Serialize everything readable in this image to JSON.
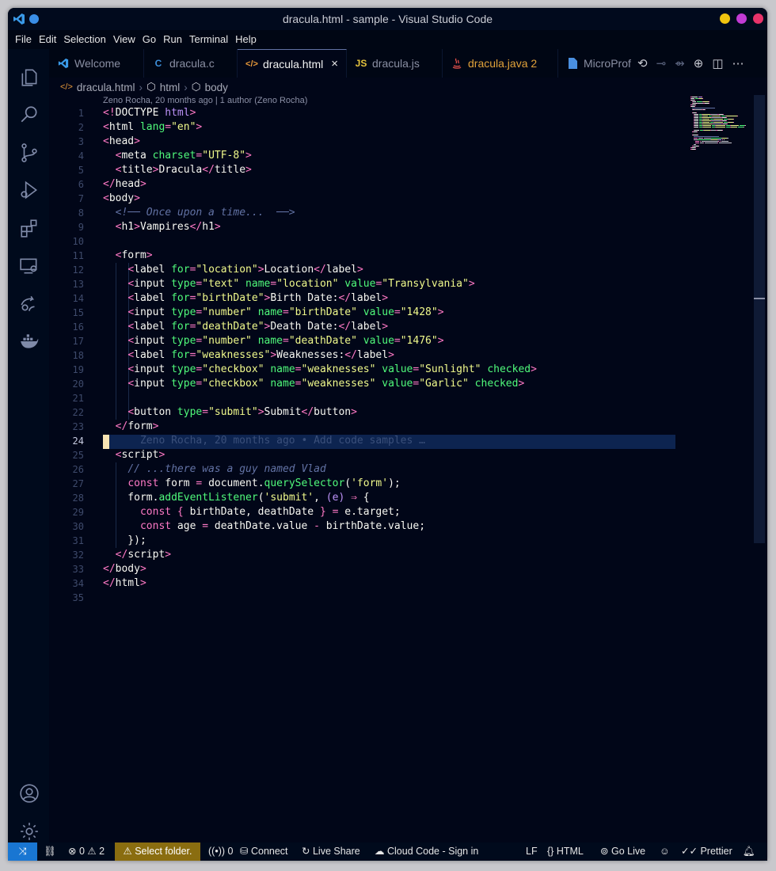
{
  "window": {
    "title": "dracula.html - sample - Visual Studio Code"
  },
  "menu": [
    "File",
    "Edit",
    "Selection",
    "View",
    "Go",
    "Run",
    "Terminal",
    "Help"
  ],
  "tabs": [
    {
      "label": "Welcome",
      "icon": "vscode-logo-icon"
    },
    {
      "label": "dracula.c",
      "icon": "c-file-icon",
      "icon_text": "C"
    },
    {
      "label": "dracula.html",
      "icon": "html-file-icon",
      "icon_text": "</>",
      "active": true
    },
    {
      "label": "dracula.js",
      "icon": "js-file-icon",
      "icon_text": "JS"
    },
    {
      "label": "dracula.java 2",
      "icon": "java-file-icon"
    },
    {
      "label": "MicroProf",
      "icon": "file-icon"
    }
  ],
  "breadcrumb": {
    "file": "dracula.html",
    "item1": "html",
    "item2": "body"
  },
  "blame_header": "Zeno Rocha, 20 months ago | 1 author (Zeno Rocha)",
  "current_line": 24,
  "line_count": 35,
  "code_lines": [
    [
      [
        "t",
        "<!"
      ],
      [
        "tn",
        "DOCTYPE"
      ],
      [
        "p",
        " html"
      ],
      [
        "t",
        ">"
      ]
    ],
    [
      [
        "t",
        "<"
      ],
      [
        "tn",
        "html"
      ],
      [
        "a",
        " lang"
      ],
      [
        "t",
        "="
      ],
      [
        "s",
        "\"en\""
      ],
      [
        "t",
        ">"
      ]
    ],
    [
      [
        "t",
        "<"
      ],
      [
        "tn",
        "head"
      ],
      [
        "t",
        ">"
      ]
    ],
    [
      [
        "v",
        "  "
      ],
      [
        "t",
        "<"
      ],
      [
        "tn",
        "meta"
      ],
      [
        "a",
        " charset"
      ],
      [
        "t",
        "="
      ],
      [
        "s",
        "\"UTF-8\""
      ],
      [
        "t",
        ">"
      ]
    ],
    [
      [
        "v",
        "  "
      ],
      [
        "t",
        "<"
      ],
      [
        "tn",
        "title"
      ],
      [
        "t",
        ">"
      ],
      [
        "v",
        "Dracula"
      ],
      [
        "t",
        "</"
      ],
      [
        "tn",
        "title"
      ],
      [
        "t",
        ">"
      ]
    ],
    [
      [
        "t",
        "</"
      ],
      [
        "tn",
        "head"
      ],
      [
        "t",
        ">"
      ]
    ],
    [
      [
        "t",
        "<"
      ],
      [
        "tn",
        "body"
      ],
      [
        "t",
        ">"
      ]
    ],
    [
      [
        "v",
        "  "
      ],
      [
        "c",
        "<!── Once upon a time...  ──>"
      ]
    ],
    [
      [
        "v",
        "  "
      ],
      [
        "t",
        "<"
      ],
      [
        "tn",
        "h1"
      ],
      [
        "t",
        ">"
      ],
      [
        "v",
        "Vampires"
      ],
      [
        "t",
        "</"
      ],
      [
        "tn",
        "h1"
      ],
      [
        "t",
        ">"
      ]
    ],
    [],
    [
      [
        "v",
        "  "
      ],
      [
        "t",
        "<"
      ],
      [
        "tn",
        "form"
      ],
      [
        "t",
        ">"
      ]
    ],
    [
      [
        "v",
        "    "
      ],
      [
        "t",
        "<"
      ],
      [
        "tn",
        "label"
      ],
      [
        "a",
        " for"
      ],
      [
        "t",
        "="
      ],
      [
        "s",
        "\"location\""
      ],
      [
        "t",
        ">"
      ],
      [
        "v",
        "Location"
      ],
      [
        "t",
        "</"
      ],
      [
        "tn",
        "label"
      ],
      [
        "t",
        ">"
      ]
    ],
    [
      [
        "v",
        "    "
      ],
      [
        "t",
        "<"
      ],
      [
        "tn",
        "input"
      ],
      [
        "a",
        " type"
      ],
      [
        "t",
        "="
      ],
      [
        "s",
        "\"text\""
      ],
      [
        "a",
        " name"
      ],
      [
        "t",
        "="
      ],
      [
        "s",
        "\"location\""
      ],
      [
        "a",
        " value"
      ],
      [
        "t",
        "="
      ],
      [
        "s",
        "\"Transylvania\""
      ],
      [
        "t",
        ">"
      ]
    ],
    [
      [
        "v",
        "    "
      ],
      [
        "t",
        "<"
      ],
      [
        "tn",
        "label"
      ],
      [
        "a",
        " for"
      ],
      [
        "t",
        "="
      ],
      [
        "s",
        "\"birthDate\""
      ],
      [
        "t",
        ">"
      ],
      [
        "v",
        "Birth Date:"
      ],
      [
        "t",
        "</"
      ],
      [
        "tn",
        "label"
      ],
      [
        "t",
        ">"
      ]
    ],
    [
      [
        "v",
        "    "
      ],
      [
        "t",
        "<"
      ],
      [
        "tn",
        "input"
      ],
      [
        "a",
        " type"
      ],
      [
        "t",
        "="
      ],
      [
        "s",
        "\"number\""
      ],
      [
        "a",
        " name"
      ],
      [
        "t",
        "="
      ],
      [
        "s",
        "\"birthDate\""
      ],
      [
        "a",
        " value"
      ],
      [
        "t",
        "="
      ],
      [
        "s",
        "\"1428\""
      ],
      [
        "t",
        ">"
      ]
    ],
    [
      [
        "v",
        "    "
      ],
      [
        "t",
        "<"
      ],
      [
        "tn",
        "label"
      ],
      [
        "a",
        " for"
      ],
      [
        "t",
        "="
      ],
      [
        "s",
        "\"deathDate\""
      ],
      [
        "t",
        ">"
      ],
      [
        "v",
        "Death Date:"
      ],
      [
        "t",
        "</"
      ],
      [
        "tn",
        "label"
      ],
      [
        "t",
        ">"
      ]
    ],
    [
      [
        "v",
        "    "
      ],
      [
        "t",
        "<"
      ],
      [
        "tn",
        "input"
      ],
      [
        "a",
        " type"
      ],
      [
        "t",
        "="
      ],
      [
        "s",
        "\"number\""
      ],
      [
        "a",
        " name"
      ],
      [
        "t",
        "="
      ],
      [
        "s",
        "\"deathDate\""
      ],
      [
        "a",
        " value"
      ],
      [
        "t",
        "="
      ],
      [
        "s",
        "\"1476\""
      ],
      [
        "t",
        ">"
      ]
    ],
    [
      [
        "v",
        "    "
      ],
      [
        "t",
        "<"
      ],
      [
        "tn",
        "label"
      ],
      [
        "a",
        " for"
      ],
      [
        "t",
        "="
      ],
      [
        "s",
        "\"weaknesses\""
      ],
      [
        "t",
        ">"
      ],
      [
        "v",
        "Weaknesses:"
      ],
      [
        "t",
        "</"
      ],
      [
        "tn",
        "label"
      ],
      [
        "t",
        ">"
      ]
    ],
    [
      [
        "v",
        "    "
      ],
      [
        "t",
        "<"
      ],
      [
        "tn",
        "input"
      ],
      [
        "a",
        " type"
      ],
      [
        "t",
        "="
      ],
      [
        "s",
        "\"checkbox\""
      ],
      [
        "a",
        " name"
      ],
      [
        "t",
        "="
      ],
      [
        "s",
        "\"weaknesses\""
      ],
      [
        "a",
        " value"
      ],
      [
        "t",
        "="
      ],
      [
        "s",
        "\"Sunlight\""
      ],
      [
        "a",
        " checked"
      ],
      [
        "t",
        ">"
      ]
    ],
    [
      [
        "v",
        "    "
      ],
      [
        "t",
        "<"
      ],
      [
        "tn",
        "input"
      ],
      [
        "a",
        " type"
      ],
      [
        "t",
        "="
      ],
      [
        "s",
        "\"checkbox\""
      ],
      [
        "a",
        " name"
      ],
      [
        "t",
        "="
      ],
      [
        "s",
        "\"weaknesses\""
      ],
      [
        "a",
        " value"
      ],
      [
        "t",
        "="
      ],
      [
        "s",
        "\"Garlic\""
      ],
      [
        "a",
        " checked"
      ],
      [
        "t",
        ">"
      ]
    ],
    [],
    [
      [
        "v",
        "    "
      ],
      [
        "t",
        "<"
      ],
      [
        "tn",
        "button"
      ],
      [
        "a",
        " type"
      ],
      [
        "t",
        "="
      ],
      [
        "s",
        "\"submit\""
      ],
      [
        "t",
        ">"
      ],
      [
        "v",
        "Submit"
      ],
      [
        "t",
        "</"
      ],
      [
        "tn",
        "button"
      ],
      [
        "t",
        ">"
      ]
    ],
    [
      [
        "v",
        "  "
      ],
      [
        "t",
        "</"
      ],
      [
        "tn",
        "form"
      ],
      [
        "t",
        ">"
      ]
    ],
    [
      [
        "ghost",
        "      Zeno Rocha, 20 months ago • Add code samples …"
      ]
    ],
    [
      [
        "v",
        "  "
      ],
      [
        "t",
        "<"
      ],
      [
        "tn",
        "script"
      ],
      [
        "t",
        ">"
      ]
    ],
    [
      [
        "v",
        "    "
      ],
      [
        "c",
        "// ...there was a guy named Vlad"
      ]
    ],
    [
      [
        "v",
        "    "
      ],
      [
        "k",
        "const"
      ],
      [
        "v",
        " form "
      ],
      [
        "pu",
        "="
      ],
      [
        "v",
        " document."
      ],
      [
        "fn",
        "querySelector"
      ],
      [
        "v",
        "("
      ],
      [
        "s",
        "'form'"
      ],
      [
        "v",
        ");"
      ]
    ],
    [
      [
        "v",
        "    form."
      ],
      [
        "fn",
        "addEventListener"
      ],
      [
        "v",
        "("
      ],
      [
        "s",
        "'submit'"
      ],
      [
        "v",
        ", "
      ],
      [
        "p",
        "(e)"
      ],
      [
        "pu",
        " ⇒"
      ],
      [
        "v",
        " {"
      ]
    ],
    [
      [
        "v",
        "      "
      ],
      [
        "k",
        "const"
      ],
      [
        "pu",
        " {"
      ],
      [
        "v",
        " birthDate, deathDate "
      ],
      [
        "pu",
        "}"
      ],
      [
        "pu",
        " ="
      ],
      [
        "v",
        " e.target;"
      ]
    ],
    [
      [
        "v",
        "      "
      ],
      [
        "k",
        "const"
      ],
      [
        "v",
        " age "
      ],
      [
        "pu",
        "="
      ],
      [
        "v",
        " deathDate.value "
      ],
      [
        "pu",
        "-"
      ],
      [
        "v",
        " birthDate.value;"
      ]
    ],
    [
      [
        "v",
        "    });"
      ]
    ],
    [
      [
        "v",
        "  "
      ],
      [
        "t",
        "</"
      ],
      [
        "tn",
        "script"
      ],
      [
        "t",
        ">"
      ]
    ],
    [
      [
        "t",
        "</"
      ],
      [
        "tn",
        "body"
      ],
      [
        "t",
        ">"
      ]
    ],
    [
      [
        "t",
        "</"
      ],
      [
        "tn",
        "html"
      ],
      [
        "t",
        ">"
      ]
    ],
    []
  ],
  "status": {
    "problems_errors": "0",
    "problems_warnings": "2",
    "select_folder": "Select folder.",
    "ports": "0",
    "connect": "Connect",
    "live_share": "Live Share",
    "cloud_code": "Cloud Code - Sign in",
    "eol": "LF",
    "language": "HTML",
    "go_live": "Go Live",
    "prettier": "Prettier"
  },
  "colors": {
    "background": "#010618",
    "accent": "#1976d2",
    "warning": "#8a6d10"
  }
}
